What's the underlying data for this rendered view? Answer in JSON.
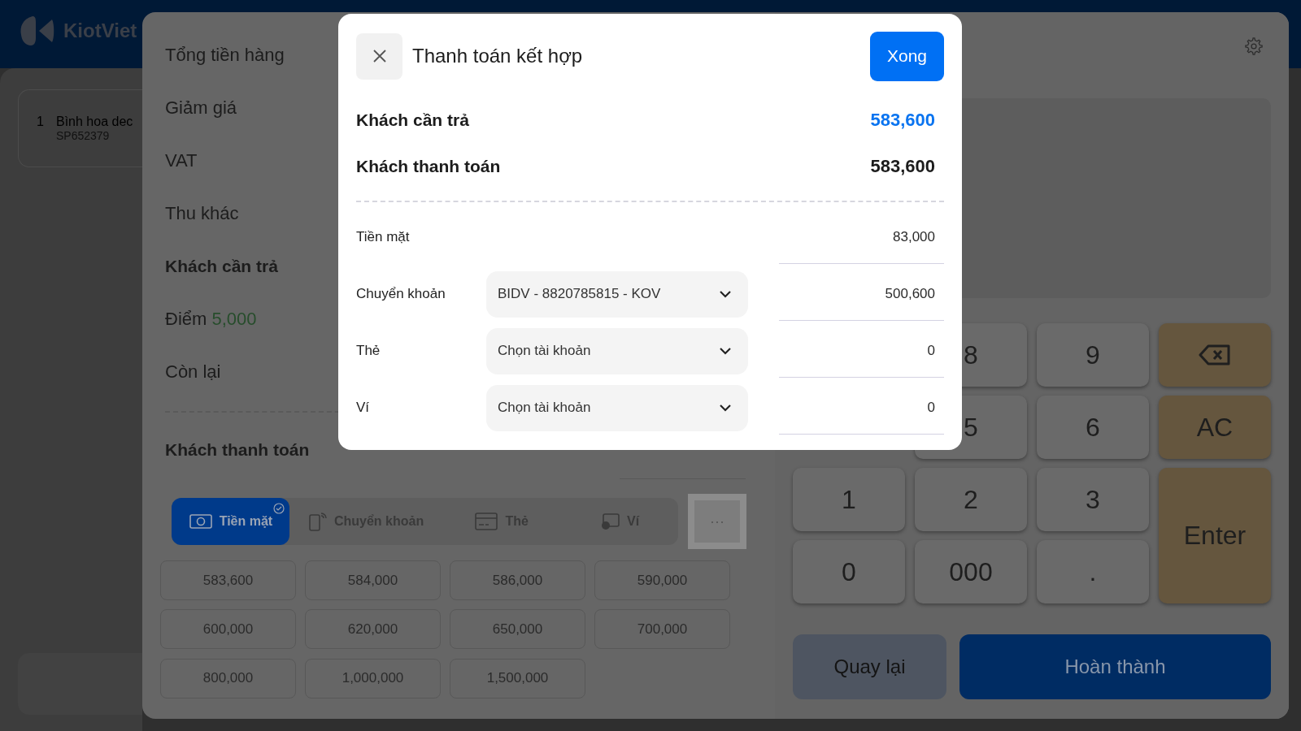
{
  "header": {
    "logo": "KiotViet"
  },
  "cart": {
    "items": [
      {
        "index": "1",
        "name": "Bình hoa dec",
        "code": "SP652379"
      }
    ]
  },
  "summary": {
    "rows": [
      {
        "label": "Tổng tiền hàng",
        "kind": "plain"
      },
      {
        "label": "Giảm giá",
        "kind": "plain"
      },
      {
        "label": "VAT",
        "kind": "plain"
      },
      {
        "label": "Thu khác",
        "kind": "plain"
      },
      {
        "label": "Khách cần trả",
        "kind": "bold"
      },
      {
        "label": "Điểm",
        "points": "5,000",
        "kind": "points"
      },
      {
        "label": "Còn lại",
        "kind": "plain"
      }
    ]
  },
  "customer_payment": {
    "label": "Khách thanh toán"
  },
  "method_tabs": [
    {
      "label": "Tiền mặt",
      "kind": "cash",
      "selected": true
    },
    {
      "label": "Chuyển khoản",
      "kind": "transfer",
      "selected": false
    },
    {
      "label": "Thẻ",
      "kind": "card",
      "selected": false
    },
    {
      "label": "Ví",
      "kind": "wallet",
      "selected": false
    }
  ],
  "more_button": {
    "label": "···"
  },
  "quick_amounts": [
    "583,600",
    "584,000",
    "586,000",
    "590,000",
    "600,000",
    "620,000",
    "650,000",
    "700,000",
    "800,000",
    "1,000,000",
    "1,500,000"
  ],
  "keypad": {
    "keys": [
      {
        "label": "8",
        "kind": "digit"
      },
      {
        "label": "9",
        "kind": "digit"
      },
      {
        "kind": "backspace"
      },
      {
        "label": "5",
        "kind": "digit"
      },
      {
        "label": "6",
        "kind": "digit"
      },
      {
        "label": "AC",
        "kind": "action"
      },
      {
        "label": "1",
        "kind": "digit"
      },
      {
        "label": "2",
        "kind": "digit"
      },
      {
        "label": "3",
        "kind": "digit"
      },
      {
        "label": "Enter",
        "kind": "enter"
      },
      {
        "label": "0",
        "kind": "digit"
      },
      {
        "label": "000",
        "kind": "digit"
      },
      {
        "label": ".",
        "kind": "digit"
      }
    ]
  },
  "actions": [
    {
      "label": "Quay lại",
      "kind": "secondary"
    },
    {
      "label": "Hoàn thành",
      "kind": "primary"
    }
  ],
  "modal": {
    "title": "Thanh toán kết hợp",
    "done_button": "Xong",
    "due": {
      "label": "Khách cần trả",
      "value": "583,600"
    },
    "paid": {
      "label": "Khách thanh toán",
      "value": "583,600"
    },
    "methods": [
      {
        "label": "Tiền mặt",
        "amount": "83,000"
      },
      {
        "label": "Chuyển khoản",
        "value": "BIDV - 8820785815 - KOV",
        "amount": "500,600"
      },
      {
        "label": "Thẻ",
        "placeholder": "Chọn tài khoản",
        "amount": "0"
      },
      {
        "label": "Ví",
        "placeholder": "Chọn tài khoản",
        "amount": "0"
      }
    ]
  }
}
